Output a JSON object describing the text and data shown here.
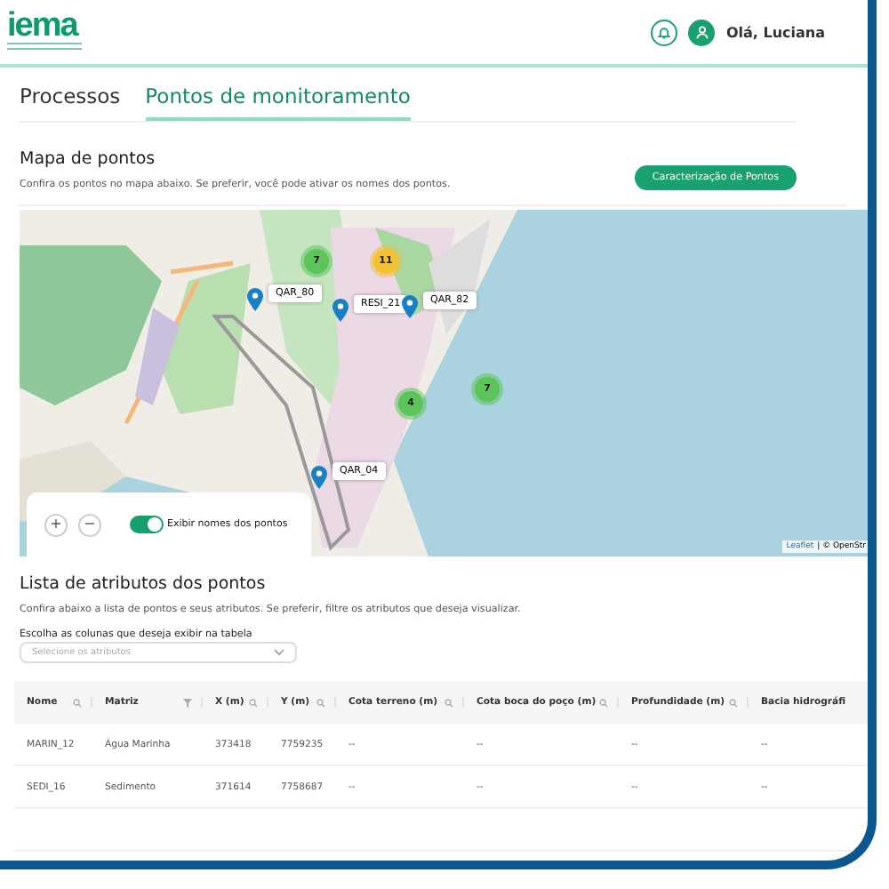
{
  "header": {
    "logo": "iema",
    "user_greeting": "Olá, Luciana"
  },
  "tabs": [
    {
      "label": "Processos",
      "selected": false
    },
    {
      "label": "Pontos de monitoramento",
      "selected": true
    }
  ],
  "map_section": {
    "title": "Mapa de pontos",
    "description": "Confira os pontos no mapa abaixo. Se preferir, você pode ativar os nomes dos pontos.",
    "button": "Caracterização de Pontos",
    "clusters": [
      {
        "count": "7",
        "color": "#5cc45a"
      },
      {
        "count": "11",
        "color": "#f2c230"
      },
      {
        "count": "4",
        "color": "#5cc45a"
      },
      {
        "count": "7",
        "color": "#5cc45a"
      }
    ],
    "pins": [
      {
        "label": "QAR_80"
      },
      {
        "label": "RESI_21"
      },
      {
        "label": "QAR_82"
      },
      {
        "label": "QAR_04"
      }
    ],
    "controls": {
      "zoom_in": "+",
      "zoom_out": "−",
      "toggle_label": "Exibir nomes dos pontos",
      "toggle_on": true
    },
    "attribution": {
      "link": "Leaflet",
      "text": "| © OpenStr"
    }
  },
  "list_section": {
    "title": "Lista de atributos dos pontos",
    "description": "Confira abaixo a lista de pontos e seus atributos. Se preferir, filtre os atributos que deseja visualizar.",
    "select_label": "Escolha as colunas que deseja exibir na tabela",
    "select_placeholder": "Selecione os atributos",
    "columns": [
      {
        "label": "Nome",
        "kind": "search"
      },
      {
        "label": "Matriz",
        "kind": "filter"
      },
      {
        "label": "X (m)",
        "kind": "search"
      },
      {
        "label": "Y (m)",
        "kind": "search"
      },
      {
        "label": "Cota terreno (m)",
        "kind": "search"
      },
      {
        "label": "Cota boca do poço (m)",
        "kind": "search"
      },
      {
        "label": "Profundidade (m)",
        "kind": "search"
      },
      {
        "label": "Bacia hidrográfi",
        "kind": "plain"
      }
    ],
    "rows": [
      [
        "MARIN_12",
        "Água Marinha",
        "373418",
        "7759235",
        "--",
        "--",
        "--",
        "--"
      ],
      [
        "SEDI_16",
        "Sedimento",
        "371614",
        "7758687",
        "--",
        "--",
        "--",
        "--"
      ]
    ]
  }
}
